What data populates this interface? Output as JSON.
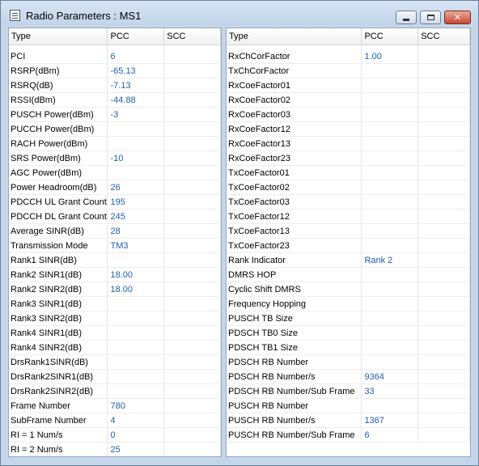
{
  "window": {
    "title": "Radio Parameters : MS1"
  },
  "left_table": {
    "headers": [
      "Type",
      "PCC",
      "SCC"
    ],
    "rows": [
      [
        "PCI",
        "6",
        ""
      ],
      [
        "RSRP(dBm)",
        "-65.13",
        ""
      ],
      [
        "RSRQ(dB)",
        "-7.13",
        ""
      ],
      [
        "RSSI(dBm)",
        "-44.88",
        ""
      ],
      [
        "PUSCH Power(dBm)",
        "-3",
        ""
      ],
      [
        "PUCCH Power(dBm)",
        "",
        ""
      ],
      [
        "RACH Power(dBm)",
        "",
        ""
      ],
      [
        "SRS Power(dBm)",
        "-10",
        ""
      ],
      [
        "AGC Power(dBm)",
        "",
        ""
      ],
      [
        "Power Headroom(dB)",
        "26",
        ""
      ],
      [
        "PDCCH UL Grant Count",
        "195",
        ""
      ],
      [
        "PDCCH DL Grant Count",
        "245",
        ""
      ],
      [
        "Average SINR(dB)",
        "28",
        ""
      ],
      [
        "Transmission Mode",
        "TM3",
        ""
      ],
      [
        "Rank1 SINR(dB)",
        "",
        ""
      ],
      [
        "Rank2 SINR1(dB)",
        "18.00",
        ""
      ],
      [
        "Rank2 SINR2(dB)",
        "18.00",
        ""
      ],
      [
        "Rank3 SINR1(dB)",
        "",
        ""
      ],
      [
        "Rank3 SINR2(dB)",
        "",
        ""
      ],
      [
        "Rank4 SINR1(dB)",
        "",
        ""
      ],
      [
        "Rank4 SINR2(dB)",
        "",
        ""
      ],
      [
        "DrsRank1SINR(dB)",
        "",
        ""
      ],
      [
        "DrsRank2SINR1(dB)",
        "",
        ""
      ],
      [
        "DrsRank2SINR2(dB)",
        "",
        ""
      ],
      [
        "Frame Number",
        "780",
        ""
      ],
      [
        "SubFrame Number",
        "4",
        ""
      ],
      [
        "RI = 1 Num/s",
        "0",
        ""
      ],
      [
        "RI = 2 Num/s",
        "25",
        ""
      ]
    ]
  },
  "right_table": {
    "headers": [
      "Type",
      "PCC",
      "SCC"
    ],
    "rows": [
      [
        "RxChCorFactor",
        "1.00",
        ""
      ],
      [
        "TxChCorFactor",
        "",
        ""
      ],
      [
        "RxCoeFactor01",
        "",
        ""
      ],
      [
        "RxCoeFactor02",
        "",
        ""
      ],
      [
        "RxCoeFactor03",
        "",
        ""
      ],
      [
        "RxCoeFactor12",
        "",
        ""
      ],
      [
        "RxCoeFactor13",
        "",
        ""
      ],
      [
        "RxCoeFactor23",
        "",
        ""
      ],
      [
        "TxCoeFactor01",
        "",
        ""
      ],
      [
        "TxCoeFactor02",
        "",
        ""
      ],
      [
        "TxCoeFactor03",
        "",
        ""
      ],
      [
        "TxCoeFactor12",
        "",
        ""
      ],
      [
        "TxCoeFactor13",
        "",
        ""
      ],
      [
        "TxCoeFactor23",
        "",
        ""
      ],
      [
        "Rank Indicator",
        "Rank 2",
        ""
      ],
      [
        "DMRS HOP",
        "",
        ""
      ],
      [
        "Cyclic Shift DMRS",
        "",
        ""
      ],
      [
        "Frequency Hopping",
        "",
        ""
      ],
      [
        "PUSCH TB Size",
        "",
        ""
      ],
      [
        "PDSCH TB0 Size",
        "",
        ""
      ],
      [
        "PDSCH TB1 Size",
        "",
        ""
      ],
      [
        "PDSCH RB Number",
        "",
        ""
      ],
      [
        "PDSCH RB Number/s",
        "9364",
        ""
      ],
      [
        "PDSCH RB Number/Sub Frame",
        "33",
        ""
      ],
      [
        "PUSCH RB Number",
        "",
        ""
      ],
      [
        "PUSCH RB Number/s",
        "1367",
        ""
      ],
      [
        "PUSCH RB Number/Sub Frame",
        "6",
        ""
      ]
    ]
  },
  "colors": {
    "value_text": "#1f5fb0",
    "frame": "#c5d6ea"
  }
}
